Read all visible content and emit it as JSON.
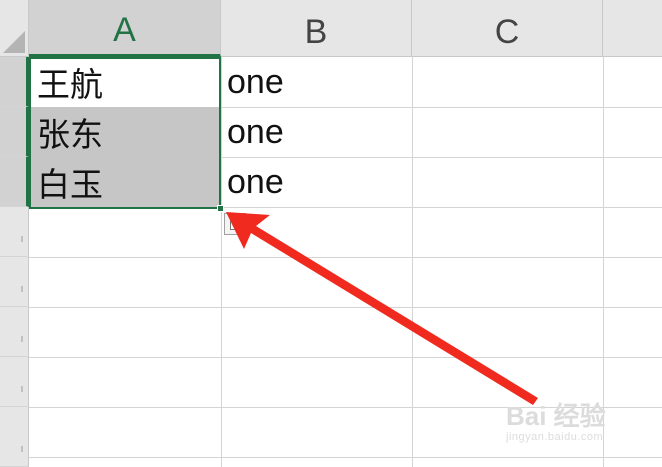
{
  "sheet": {
    "columns": [
      {
        "label": "A",
        "selected": true
      },
      {
        "label": "B",
        "selected": false
      },
      {
        "label": "C",
        "selected": false
      }
    ],
    "rows": [
      {
        "a": "王航",
        "b": "one",
        "selected": true,
        "shaded": false
      },
      {
        "a": "张东",
        "b": "one",
        "selected": true,
        "shaded": true
      },
      {
        "a": "白玉",
        "b": "one",
        "selected": true,
        "shaded": true
      },
      {
        "a": "",
        "b": "",
        "selected": false,
        "shaded": false
      },
      {
        "a": "",
        "b": "",
        "selected": false,
        "shaded": false
      },
      {
        "a": "",
        "b": "",
        "selected": false,
        "shaded": false
      },
      {
        "a": "",
        "b": "",
        "selected": false,
        "shaded": false
      },
      {
        "a": "",
        "b": "",
        "selected": false,
        "shaded": false
      }
    ]
  },
  "paste_options_icon": "paste-options-icon",
  "annotation": {
    "color": "#f02a1e",
    "icon": "red-arrow"
  },
  "watermark": {
    "logo": "Bai  经验",
    "url": "jingyan.baidu.com"
  },
  "colors": {
    "accent": "#217346",
    "selection_fill": "#c6c6c6",
    "header_bg": "#e6e6e6"
  }
}
